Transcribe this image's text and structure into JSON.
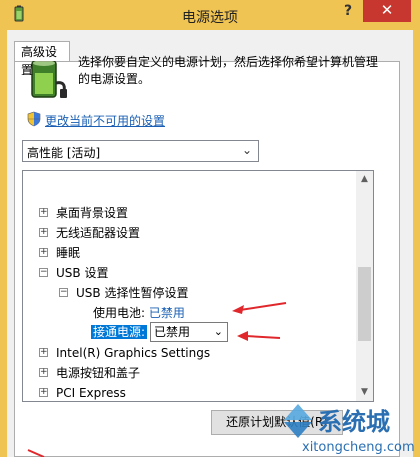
{
  "window": {
    "title": "电源选项",
    "help_label": "?",
    "close_label": "✕"
  },
  "tab": {
    "label": "高级设置"
  },
  "description": "选择你要自定义的电源计划，然后选择你希望计算机管理的电源设置。",
  "change_settings_link": "更改当前不可用的设置",
  "plan_select": {
    "value": "高性能 [活动]"
  },
  "tree": {
    "rows": [
      {
        "label": "桌面背景设置",
        "expander": "+"
      },
      {
        "label": "无线适配器设置",
        "expander": "+"
      },
      {
        "label": "睡眠",
        "expander": "+"
      },
      {
        "label": "USB 设置",
        "expander": "−"
      },
      {
        "label": "USB 选择性暂停设置",
        "expander": "−"
      },
      {
        "label": "使用电池:",
        "value": "已禁用"
      },
      {
        "label": "接通电源:",
        "value": "已禁用"
      },
      {
        "label": "Intel(R) Graphics Settings",
        "expander": "+"
      },
      {
        "label": "电源按钮和盖子",
        "expander": "+"
      },
      {
        "label": "PCI Express",
        "expander": "+"
      }
    ]
  },
  "restore_button": "还原计划默认值(R)",
  "watermark": {
    "brand": "系统城",
    "url": "xitongcheng.com"
  },
  "colors": {
    "accent_title": "#f0c453",
    "close": "#c7372f",
    "link": "#1a5fb4",
    "selection": "#0078d7",
    "arrow": "#e0282c"
  }
}
